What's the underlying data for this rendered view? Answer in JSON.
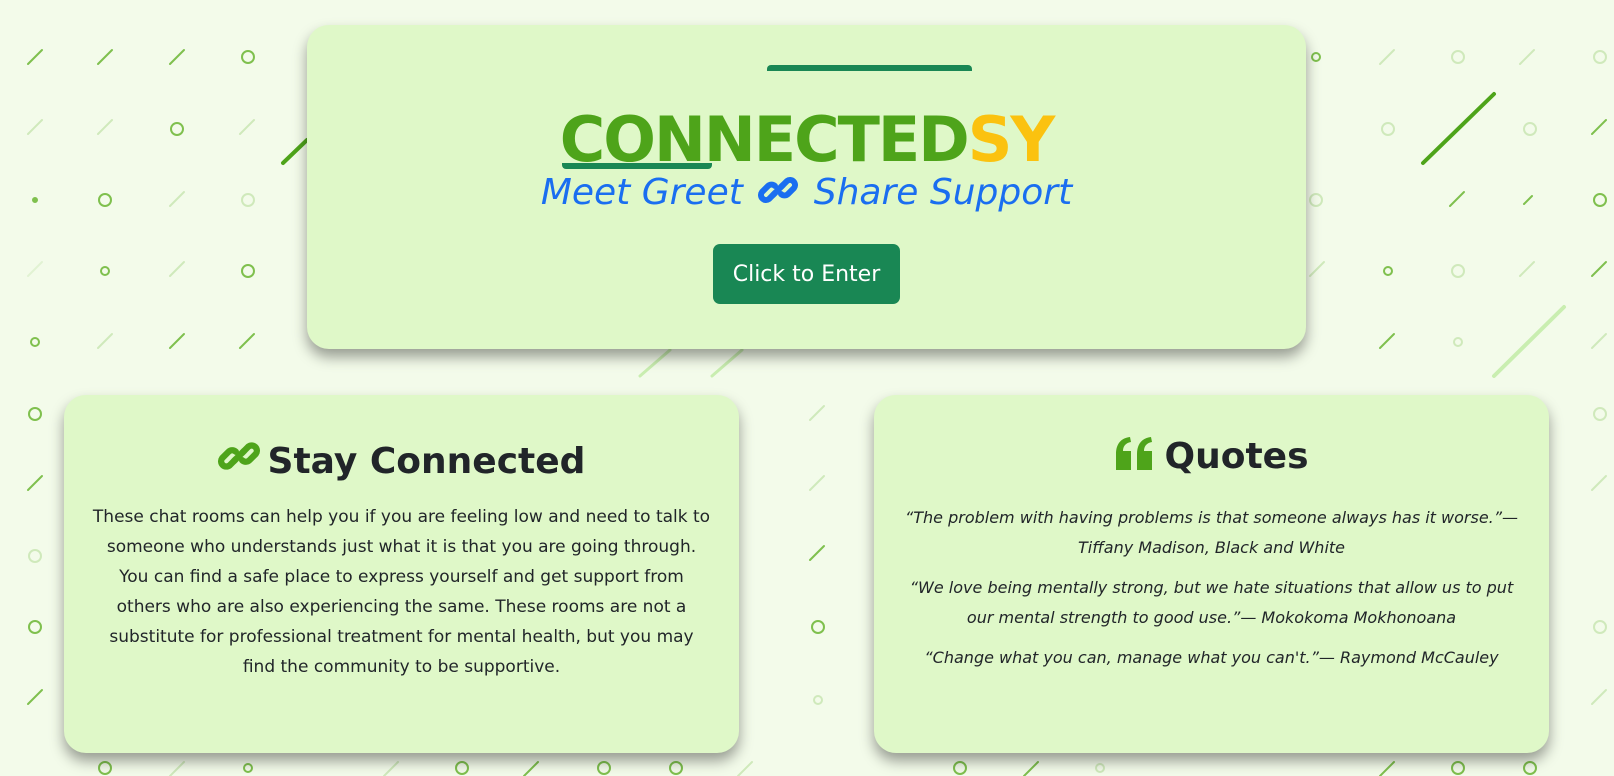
{
  "hero": {
    "brand_main": "CONNECTED",
    "brand_accent": "SY",
    "tagline_left": "Meet Greet",
    "tagline_right": "Share Support",
    "enter_button": "Click to Enter"
  },
  "connected_card": {
    "title": "Stay Connected",
    "body": "These chat rooms can help you if you are feeling low and need to talk to someone who understands just what it is that you are going through. You can find a safe place to express yourself and get support from others who are also experiencing the same. These rooms are not a substitute for professional treatment for mental health, but you may find the community to be supportive."
  },
  "quotes_card": {
    "title": "Quotes",
    "quotes": [
      "“The problem with having problems is that someone always has it worse.”— Tiffany Madison, Black and White",
      "“We love being mentally strong, but we hate situations that allow us to put our mental strength to good use.”— Mokokoma Mokhonoana",
      "“Change what you can, manage what you can't.”— Raymond McCauley"
    ]
  },
  "icons": {
    "tagline_icon": "link-icon",
    "connected_icon": "link-icon",
    "quotes_icon": "quote-left-icon"
  },
  "colors": {
    "brand_green": "#4ea41a",
    "brand_accent": "#fbc20f",
    "tagline_blue": "#1a6ef0",
    "button_green": "#198754",
    "card_bg": "#dff8c8",
    "page_bg": "#f3fbea"
  }
}
